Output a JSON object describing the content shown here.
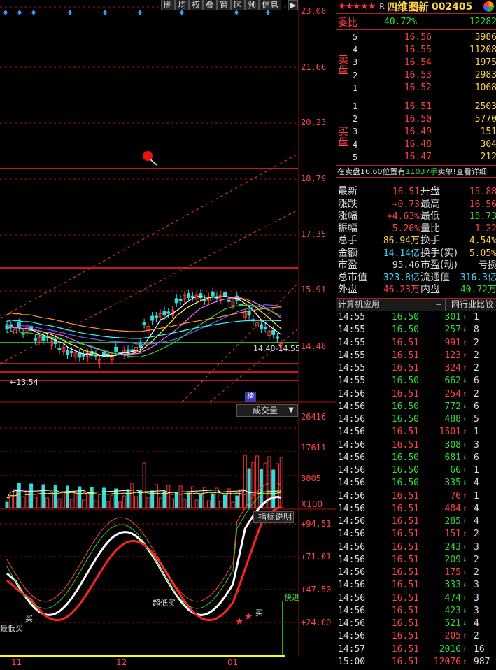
{
  "toolbar": {
    "items": [
      "删",
      "均",
      "权",
      "叠",
      "窗",
      "区",
      "预",
      "信息"
    ],
    "close": "▶"
  },
  "price_axis": [
    "23.08",
    "21.66",
    "20.23",
    "18.79",
    "17.35",
    "15.91",
    "14.48"
  ],
  "annotations": {
    "low_label": "←13.54",
    "range_label": "14.48-14.55",
    "bang": "榜"
  },
  "volume": {
    "button": "成交量",
    "axis": [
      "26416",
      "17611",
      "8805"
    ],
    "unit": "X100"
  },
  "indicator": {
    "button": "指标说明",
    "axis": [
      "+94.51",
      "+71.01",
      "+47.50",
      "+24.00"
    ],
    "notes": [
      "买",
      "最低买",
      "超低买",
      "买",
      "快进"
    ]
  },
  "dates": [
    "11",
    "12",
    "01"
  ],
  "colors": {
    "up": "#ff3333",
    "down": "#33dddd",
    "ma5": "#ffffff",
    "ma10": "#ffff33",
    "ma20": "#ff66ff",
    "ma30": "#33cc33",
    "ma60": "#6666ff",
    "ma120": "#ff9933",
    "ma250": "#33ffff"
  },
  "header": {
    "stars": "★★★★★",
    "badge": "R",
    "name": "四维图新",
    "code": "002405"
  },
  "ratio": {
    "label": "委比",
    "pct": "-40.72%",
    "diff": "-12282"
  },
  "sell_side": "卖盘",
  "buy_side": "买盘",
  "sell": [
    {
      "lvl": "5",
      "price": "16.56",
      "vol": "3986"
    },
    {
      "lvl": "4",
      "price": "16.55",
      "vol": "11208"
    },
    {
      "lvl": "3",
      "price": "16.54",
      "vol": "1975"
    },
    {
      "lvl": "2",
      "price": "16.53",
      "vol": "2983"
    },
    {
      "lvl": "1",
      "price": "16.52",
      "vol": "1068"
    }
  ],
  "buy": [
    {
      "lvl": "1",
      "price": "16.51",
      "vol": "2503"
    },
    {
      "lvl": "2",
      "price": "16.50",
      "vol": "5770"
    },
    {
      "lvl": "3",
      "price": "16.49",
      "vol": "151"
    },
    {
      "lvl": "4",
      "price": "16.48",
      "vol": "304"
    },
    {
      "lvl": "5",
      "price": "16.47",
      "vol": "212"
    }
  ],
  "status": {
    "a": "在卖盘16.60位置有",
    "b": "11037手",
    "c": "卖单!查看详细"
  },
  "quote": [
    {
      "k": "最新",
      "v": "16.51",
      "vc": "red",
      "k2": "开盘",
      "v2": "15.88",
      "v2c": "red"
    },
    {
      "k": "涨跌",
      "v": "+0.73",
      "vc": "red",
      "k2": "最高",
      "v2": "16.56",
      "v2c": "red"
    },
    {
      "k": "涨幅",
      "v": "+4.63%",
      "vc": "red",
      "k2": "最低",
      "v2": "15.73",
      "v2c": "grn"
    },
    {
      "k": "振幅",
      "v": "5.26%",
      "vc": "red",
      "k2": "量比",
      "v2": "1.22",
      "v2c": "red"
    },
    {
      "k": "总手",
      "v": "86.94万",
      "vc": "yel",
      "k2": "换手",
      "v2": "4.54%",
      "v2c": "yel"
    },
    {
      "k": "金额",
      "v": "14.14亿",
      "vc": "cyan",
      "k2": "换手(实)",
      "v2": "5.05%",
      "v2c": "yel"
    },
    {
      "k": "市盈",
      "v": "95.46",
      "vc": "wht",
      "k2": "市盈(动)",
      "v2": "亏损",
      "v2c": "wht"
    },
    {
      "k": "总市值",
      "v": "323.8亿",
      "vc": "cyan",
      "k2": "流通值",
      "v2": "316.3亿",
      "v2c": "cyan"
    },
    {
      "k": "外盘",
      "v": "46.23万",
      "vc": "red",
      "k2": "内盘",
      "v2": "40.72万",
      "v2c": "grn"
    }
  ],
  "tabs": {
    "t1": "计算机应用",
    "t1b": "−",
    "t2": "同行业比较"
  },
  "trades": [
    {
      "t": "14:55",
      "p": "16.50",
      "pc": "grn",
      "v": "301",
      "d": "down",
      "n": "1"
    },
    {
      "t": "14:55",
      "p": "16.50",
      "pc": "grn",
      "v": "257",
      "d": "down",
      "n": "8"
    },
    {
      "t": "14:55",
      "p": "16.51",
      "pc": "red",
      "v": "991",
      "d": "up",
      "n": "2"
    },
    {
      "t": "14:55",
      "p": "16.51",
      "pc": "red",
      "v": "123",
      "d": "up",
      "n": "2"
    },
    {
      "t": "14:55",
      "p": "16.51",
      "pc": "red",
      "v": "324",
      "d": "up",
      "n": "2"
    },
    {
      "t": "14:55",
      "p": "16.50",
      "pc": "grn",
      "v": "662",
      "d": "down",
      "n": "6"
    },
    {
      "t": "14:56",
      "p": "16.51",
      "pc": "red",
      "v": "254",
      "d": "up",
      "n": "2"
    },
    {
      "t": "14:56",
      "p": "16.50",
      "pc": "grn",
      "v": "772",
      "d": "down",
      "n": "6"
    },
    {
      "t": "14:56",
      "p": "16.50",
      "pc": "grn",
      "v": "488",
      "d": "down",
      "n": "5"
    },
    {
      "t": "14:56",
      "p": "16.51",
      "pc": "red",
      "v": "1501",
      "d": "up",
      "n": "1"
    },
    {
      "t": "14:56",
      "p": "16.51",
      "pc": "red",
      "v": "308",
      "d": "down",
      "n": "3"
    },
    {
      "t": "14:56",
      "p": "16.50",
      "pc": "grn",
      "v": "681",
      "d": "down",
      "n": "6"
    },
    {
      "t": "14:56",
      "p": "16.50",
      "pc": "grn",
      "v": "66",
      "d": "down",
      "n": "1"
    },
    {
      "t": "14:56",
      "p": "16.50",
      "pc": "grn",
      "v": "335",
      "d": "down",
      "n": "4"
    },
    {
      "t": "14:56",
      "p": "16.51",
      "pc": "red",
      "v": "76",
      "d": "up",
      "n": "1"
    },
    {
      "t": "14:56",
      "p": "16.51",
      "pc": "red",
      "v": "484",
      "d": "up",
      "n": "4"
    },
    {
      "t": "14:56",
      "p": "16.51",
      "pc": "red",
      "v": "285",
      "d": "down",
      "n": "4"
    },
    {
      "t": "14:56",
      "p": "16.51",
      "pc": "red",
      "v": "151",
      "d": "up",
      "n": "2"
    },
    {
      "t": "14:56",
      "p": "16.51",
      "pc": "red",
      "v": "243",
      "d": "down",
      "n": "3"
    },
    {
      "t": "14:56",
      "p": "16.51",
      "pc": "red",
      "v": "209",
      "d": "down",
      "n": "2"
    },
    {
      "t": "14:56",
      "p": "16.51",
      "pc": "red",
      "v": "175",
      "d": "up",
      "n": "2"
    },
    {
      "t": "14:56",
      "p": "16.51",
      "pc": "red",
      "v": "333",
      "d": "down",
      "n": "3"
    },
    {
      "t": "14:56",
      "p": "16.51",
      "pc": "red",
      "v": "474",
      "d": "down",
      "n": "3"
    },
    {
      "t": "14:56",
      "p": "16.51",
      "pc": "red",
      "v": "423",
      "d": "down",
      "n": "3"
    },
    {
      "t": "14:56",
      "p": "16.51",
      "pc": "red",
      "v": "521",
      "d": "down",
      "n": "4"
    },
    {
      "t": "14:56",
      "p": "16.51",
      "pc": "red",
      "v": "205",
      "d": "up",
      "n": "2"
    },
    {
      "t": "14:57",
      "p": "16.51",
      "pc": "red",
      "v": "2016",
      "d": "down",
      "n": "16"
    },
    {
      "t": "15:00",
      "p": "16.51",
      "pc": "red",
      "v": "12076",
      "d": "up",
      "n": "987"
    }
  ]
}
